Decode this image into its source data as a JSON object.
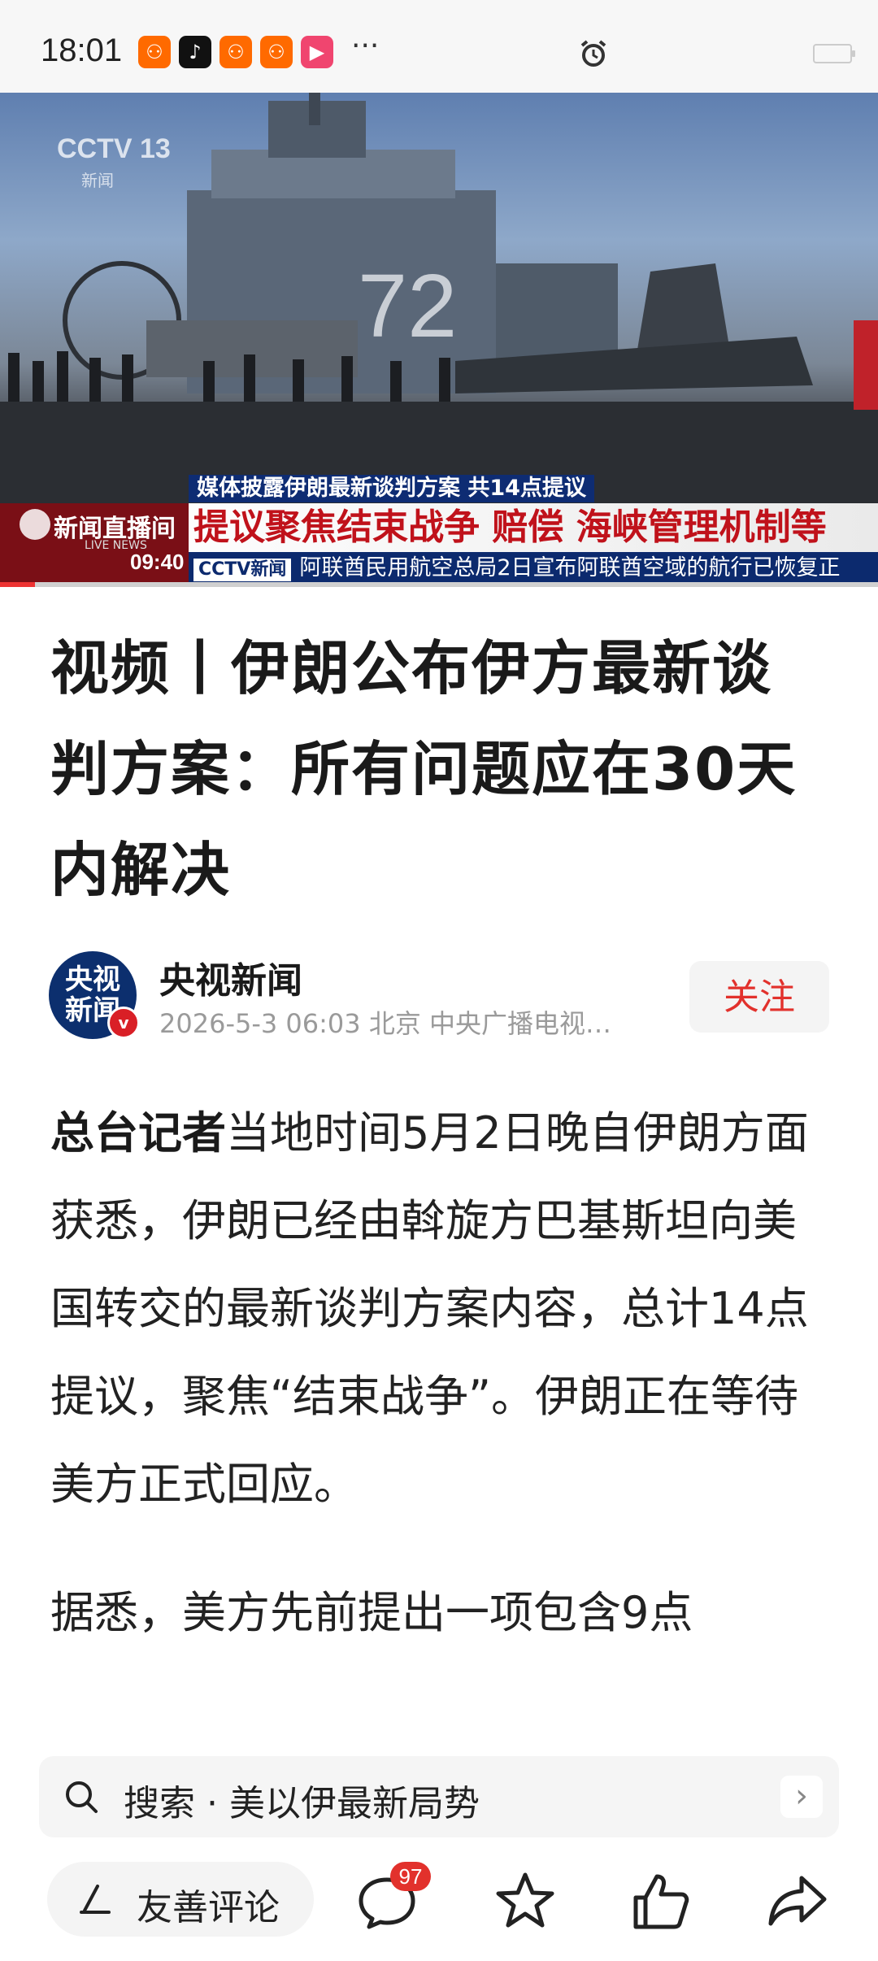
{
  "status_bar": {
    "time": "18:01",
    "more": "···"
  },
  "hero": {
    "channel_logo": "CCTV 13",
    "channel_sub": "新闻",
    "ticker_top": "媒体披露伊朗最新谈判方案 共14点提议",
    "ticker_main": "提议聚焦结束战争 赔偿 海峡管理机制等",
    "live_label": "新闻直播间",
    "live_sub": "LIVE NEWS",
    "clock": "09:40",
    "tag": "CCTV新闻",
    "ticker_bottom": "阿联酋民用航空总局2日宣布阿联酋空域的航行已恢复正",
    "progress": 0.04
  },
  "article": {
    "title": "视频丨伊朗公布伊方最新谈判方案：所有问题应在30天内解决",
    "author": {
      "avatar_text": "央视新闻",
      "name": "央视新闻",
      "meta": "2026-5-3  06:03  北京  中央广播电视…",
      "follow_label": "关注"
    },
    "lead_bold": "总台记者",
    "paragraph1": "当地时间5月2日晚自伊朗方面获悉，伊朗已经由斡旋方巴基斯坦向美国转交的最新谈判方案内容，总计14点提议，聚焦“结束战争”。伊朗正在等待美方正式回应。",
    "paragraph2": "据悉，美方先前提出一项包含9点"
  },
  "search": {
    "text": "搜索 · 美以伊最新局势"
  },
  "bottom_bar": {
    "comment_placeholder": "友善评论",
    "comment_count": "97",
    "accent_color": "#e2312c"
  }
}
